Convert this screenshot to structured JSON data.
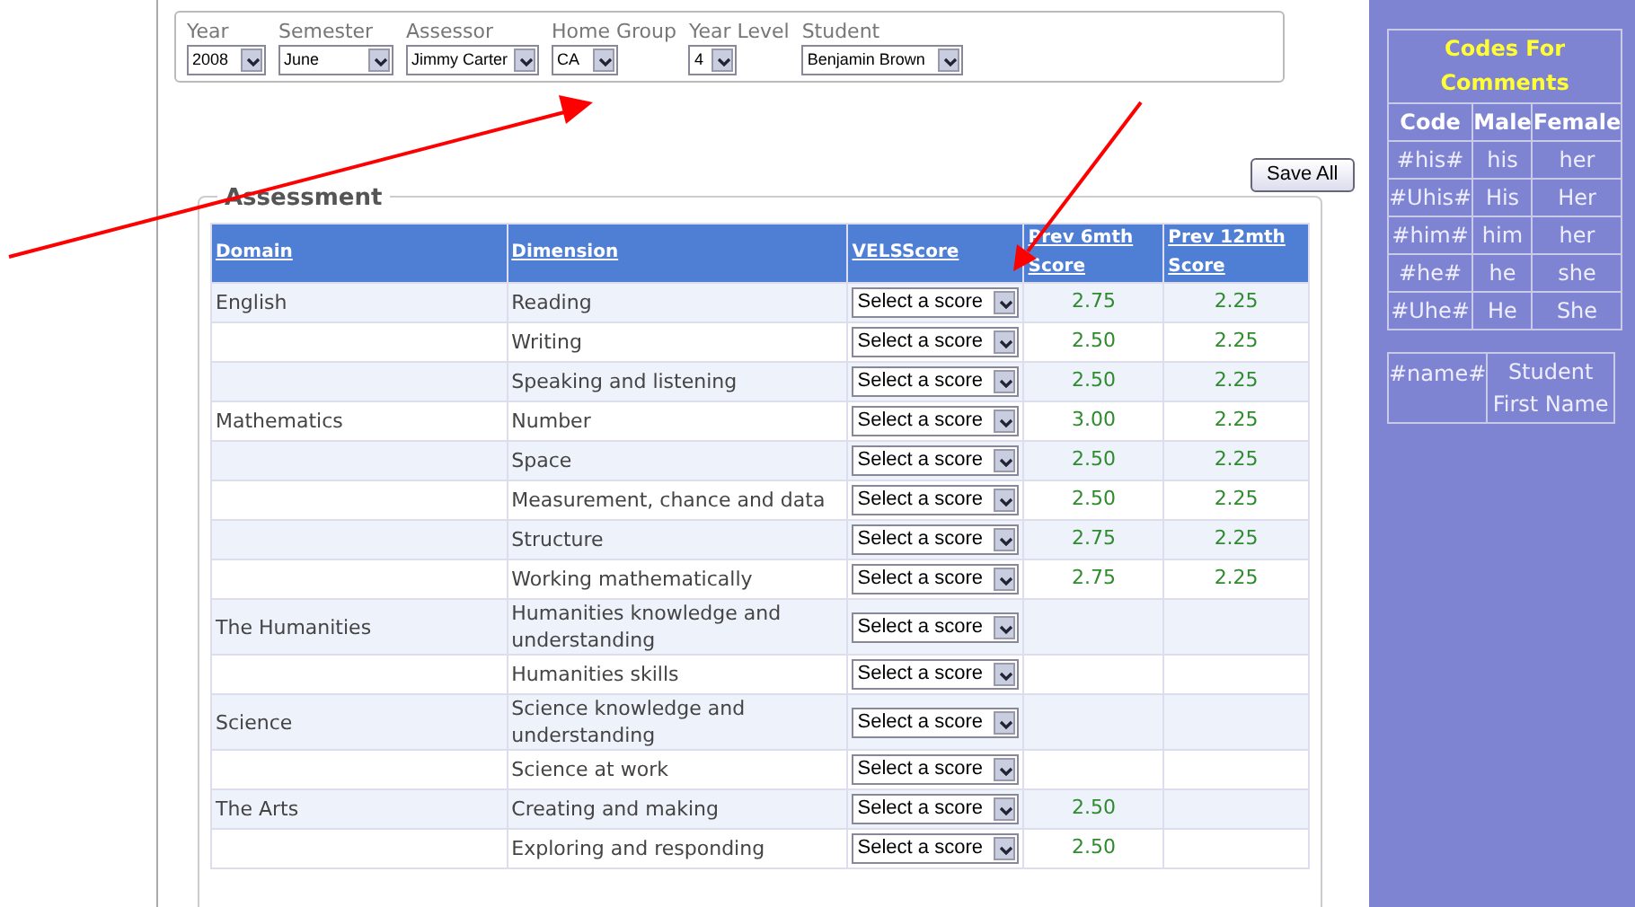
{
  "filters": [
    {
      "label": "Year",
      "value": "2008"
    },
    {
      "label": "Semester",
      "value": "June"
    },
    {
      "label": "Assessor",
      "value": "Jimmy Carter"
    },
    {
      "label": "Home Group",
      "value": "CA"
    },
    {
      "label": "Year Level",
      "value": "4"
    },
    {
      "label": "Student",
      "value": "Benjamin Brown"
    }
  ],
  "save_button": "Save All",
  "assessment": {
    "legend": "Assessment",
    "columns": [
      "Domain",
      "Dimension",
      "VELSScore",
      "Prev 6mth Score",
      "Prev 12mth Score"
    ],
    "rows": [
      {
        "domain": "English",
        "dimension": "Reading",
        "score": "Select a score",
        "prev_6": "2.75",
        "prev_12": "2.25"
      },
      {
        "dimension": "Writing",
        "score": "Select a score",
        "prev_6": "2.50",
        "prev_12": "2.25"
      },
      {
        "dimension": "Speaking and listening",
        "score": "Select a score",
        "prev_6": "2.50",
        "prev_12": "2.25"
      },
      {
        "domain": "Mathematics",
        "dimension": "Number",
        "score": "Select a score",
        "prev_6": "3.00",
        "prev_12": "2.25"
      },
      {
        "dimension": "Space",
        "score": "Select a score",
        "prev_6": "2.50",
        "prev_12": "2.25"
      },
      {
        "dimension": "Measurement, chance and data",
        "score": "Select a score",
        "prev_6": "2.50",
        "prev_12": "2.25"
      },
      {
        "dimension": "Structure",
        "score": "Select a score",
        "prev_6": "2.75",
        "prev_12": "2.25"
      },
      {
        "dimension": "Working mathematically",
        "score": "Select a score",
        "prev_6": "2.75",
        "prev_12": "2.25"
      },
      {
        "domain": "The Humanities",
        "dimension": "Humanities knowledge and understanding",
        "score": "Select a score"
      },
      {
        "dimension": "Humanities skills",
        "score": "Select a score"
      },
      {
        "domain": "Science",
        "dimension": "Science knowledge and understanding",
        "score": "Select a score"
      },
      {
        "dimension": "Science at work",
        "score": "Select a score"
      },
      {
        "domain": "The Arts",
        "dimension": "Creating and making",
        "score": "Select a score",
        "prev_6": "2.50"
      },
      {
        "dimension": "Exploring and responding",
        "score": "Select a score",
        "prev_6": "2.50"
      }
    ]
  },
  "codes": {
    "title": "Codes For Comments",
    "columns": [
      "Code",
      "Male",
      "Female"
    ],
    "rows": [
      [
        "#his#",
        "his",
        "her"
      ],
      [
        "#Uhis#",
        "His",
        "Her"
      ],
      [
        "#him#",
        "him",
        "her"
      ],
      [
        "#he#",
        "he",
        "she"
      ],
      [
        "#Uhe#",
        "He",
        "She"
      ]
    ],
    "name_code": {
      "code": "#name#",
      "meaning": "Student First Name"
    }
  }
}
